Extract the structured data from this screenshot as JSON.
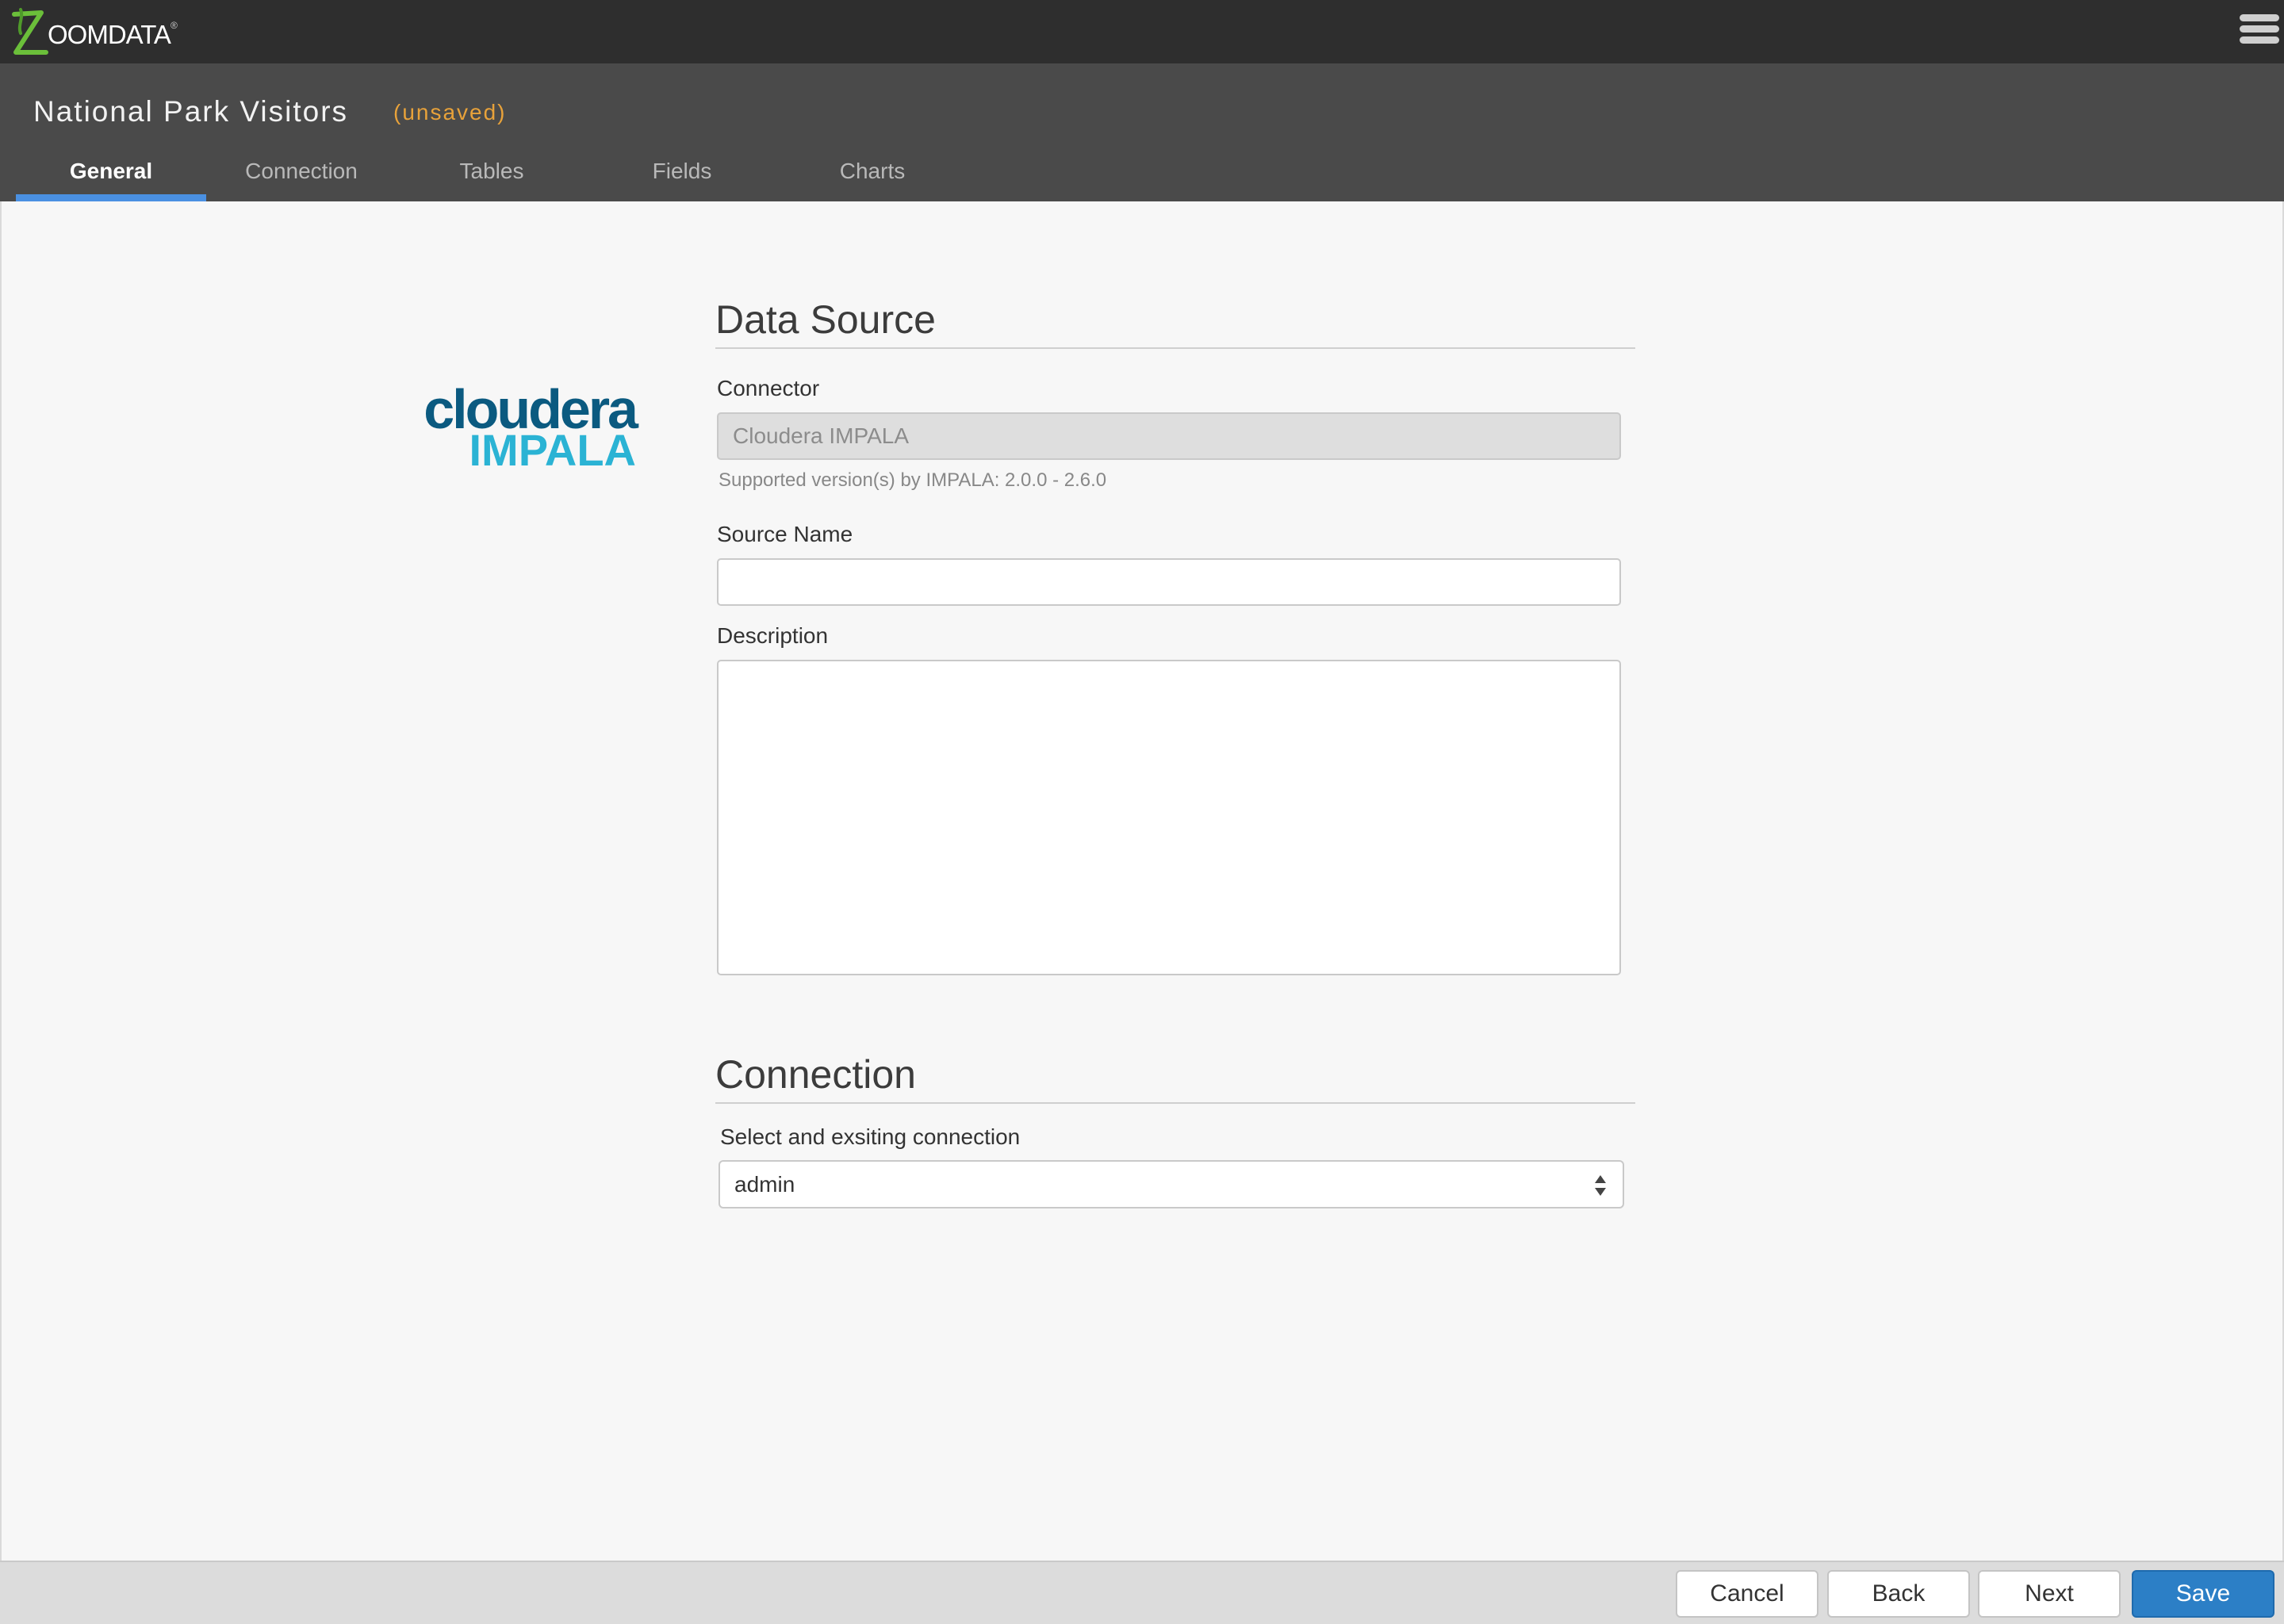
{
  "app": {
    "logo_text": "OOMDATA",
    "logo_reg": "®"
  },
  "header": {
    "title": "National Park Visitors",
    "status": "(unsaved)",
    "tabs": [
      {
        "label": "General",
        "active": true
      },
      {
        "label": "Connection",
        "active": false
      },
      {
        "label": "Tables",
        "active": false
      },
      {
        "label": "Fields",
        "active": false
      },
      {
        "label": "Charts",
        "active": false
      }
    ]
  },
  "connector_logo": {
    "line1": "cloudera",
    "line2": "IMPALA"
  },
  "data_source": {
    "heading": "Data Source",
    "connector_label": "Connector",
    "connector_value": "Cloudera IMPALA",
    "supported_versions": "Supported version(s) by IMPALA: 2.0.0 - 2.6.0",
    "source_name_label": "Source Name",
    "source_name_value": "",
    "description_label": "Description",
    "description_value": ""
  },
  "connection": {
    "heading": "Connection",
    "select_label": "Select and exsiting connection",
    "selected": "admin"
  },
  "footer": {
    "cancel": "Cancel",
    "back": "Back",
    "next": "Next",
    "save": "Save"
  },
  "colors": {
    "accent": "#4a90e2",
    "unsaved": "#e8a23a",
    "primary_button": "#2c7fc6",
    "logo_green": "#6bbf3a"
  }
}
